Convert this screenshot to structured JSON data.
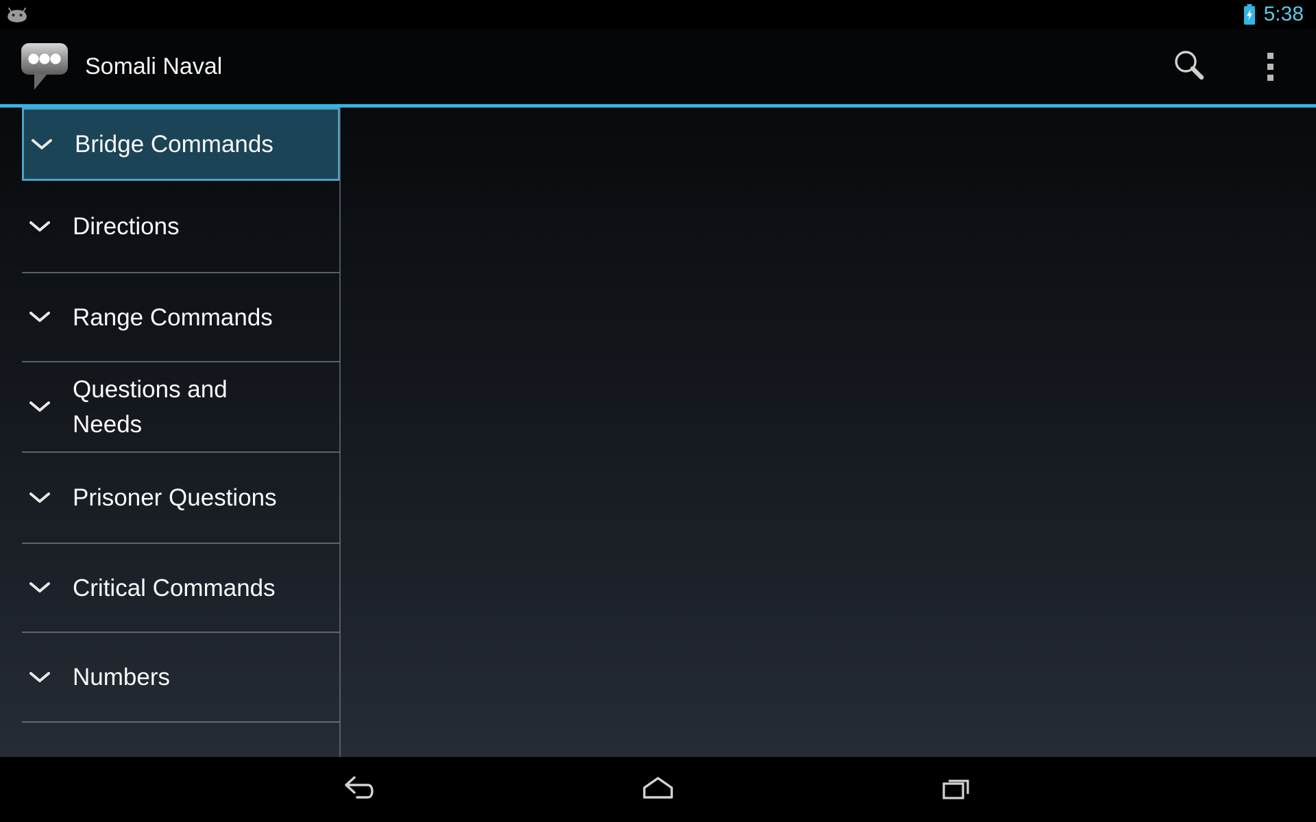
{
  "status_bar": {
    "notification_icon": "android-robot-icon",
    "battery_icon": "battery-charging-icon",
    "clock": "5:38",
    "clock_color": "#5fc8e8",
    "battery_color": "#33b5e5"
  },
  "action_bar": {
    "app_icon": "speech-bubble-icon",
    "title": "Somali Naval",
    "search_icon": "search-icon",
    "overflow_icon": "overflow-menu-icon",
    "accent_color": "#33b5e5"
  },
  "list": {
    "selected_index": 0,
    "selection_fill": "#1b4457",
    "selection_border": "#4aa3c7",
    "expand_icon": "chevron-down-icon",
    "items": [
      {
        "label": "Bridge Commands",
        "selected": true,
        "wrap": false
      },
      {
        "label": "Directions",
        "selected": false,
        "wrap": false
      },
      {
        "label": "Range Commands",
        "selected": false,
        "wrap": false
      },
      {
        "label": "Questions and Needs",
        "selected": false,
        "wrap": true
      },
      {
        "label": "Prisoner Questions",
        "selected": false,
        "wrap": false
      },
      {
        "label": "Critical Commands",
        "selected": false,
        "wrap": false
      },
      {
        "label": "Numbers",
        "selected": false,
        "wrap": false
      }
    ]
  },
  "detail_pane": {
    "content": ""
  },
  "nav_bar": {
    "back_icon": "back-arrow-icon",
    "home_icon": "home-icon",
    "recents_icon": "recent-apps-icon"
  }
}
